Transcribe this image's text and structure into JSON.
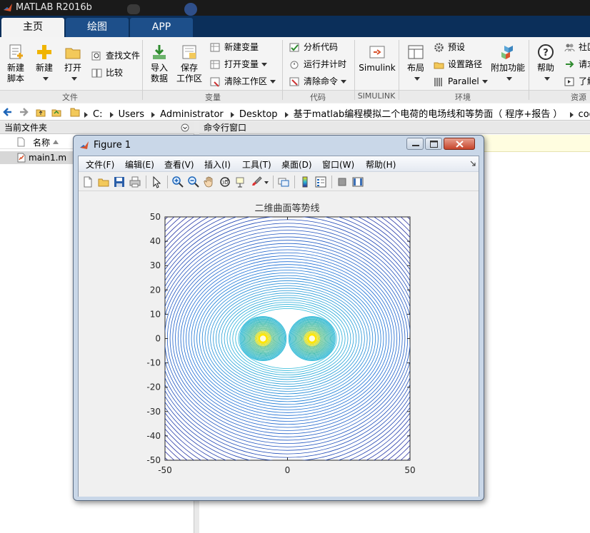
{
  "app": {
    "title": "MATLAB R2016b"
  },
  "tabs": [
    {
      "label": "主页"
    },
    {
      "label": "绘图"
    },
    {
      "label": "APP"
    }
  ],
  "ribbon": {
    "file": {
      "new_script": "新建\n脚本",
      "new": "新建",
      "open": "打开",
      "find_files": "查找文件",
      "compare": "比较",
      "section": "文件"
    },
    "variable": {
      "import": "导入\n数据",
      "save_workspace": "保存\n工作区",
      "new_variable": "新建变量",
      "open_variable": "打开变量",
      "clear_workspace": "清除工作区",
      "section": "变量"
    },
    "code": {
      "analyze": "分析代码",
      "run_time": "运行并计时",
      "clear_commands": "清除命令",
      "section": "代码"
    },
    "simulink": {
      "label": "Simulink",
      "section": "SIMULINK"
    },
    "environment": {
      "layout": "布局",
      "preferences": "预设",
      "set_path": "设置路径",
      "parallel": "Parallel",
      "addons": "附加功能",
      "section": "环境"
    },
    "resources": {
      "help": "帮助",
      "community": "社区",
      "request": "请求",
      "learn": "了解",
      "section": "资源"
    }
  },
  "address": {
    "crumbs": [
      "C:",
      "Users",
      "Administrator",
      "Desktop",
      "基于matlab编程模拟二个电荷的电场线和等势面（ 程序+报告 ）",
      "code"
    ]
  },
  "current_folder": {
    "header": "当前文件夹",
    "col_name": "名称",
    "files": [
      {
        "name": "main1.m"
      }
    ]
  },
  "command_window": {
    "header": "命令行窗口"
  },
  "figure": {
    "title": "Figure 1",
    "menus": [
      "文件(F)",
      "编辑(E)",
      "查看(V)",
      "插入(I)",
      "工具(T)",
      "桌面(D)",
      "窗口(W)",
      "帮助(H)"
    ]
  },
  "chart_data": {
    "type": "contour",
    "title": "二维曲面等势线",
    "xlabel": "",
    "ylabel": "",
    "xlim": [
      -50,
      50
    ],
    "ylim": [
      -50,
      50
    ],
    "xticks": [
      -50,
      0,
      50
    ],
    "yticks": [
      50,
      40,
      30,
      20,
      10,
      0,
      -10,
      -20,
      -30,
      -40,
      -50
    ],
    "charges": [
      {
        "x": -10,
        "y": 0
      },
      {
        "x": 10,
        "y": 0
      }
    ],
    "colormap": "parula",
    "colors": {
      "outer": "#2a2a9a",
      "mid": "#1a6fd6",
      "inner": "#2bb8d8",
      "peak": "#ffe600"
    }
  }
}
